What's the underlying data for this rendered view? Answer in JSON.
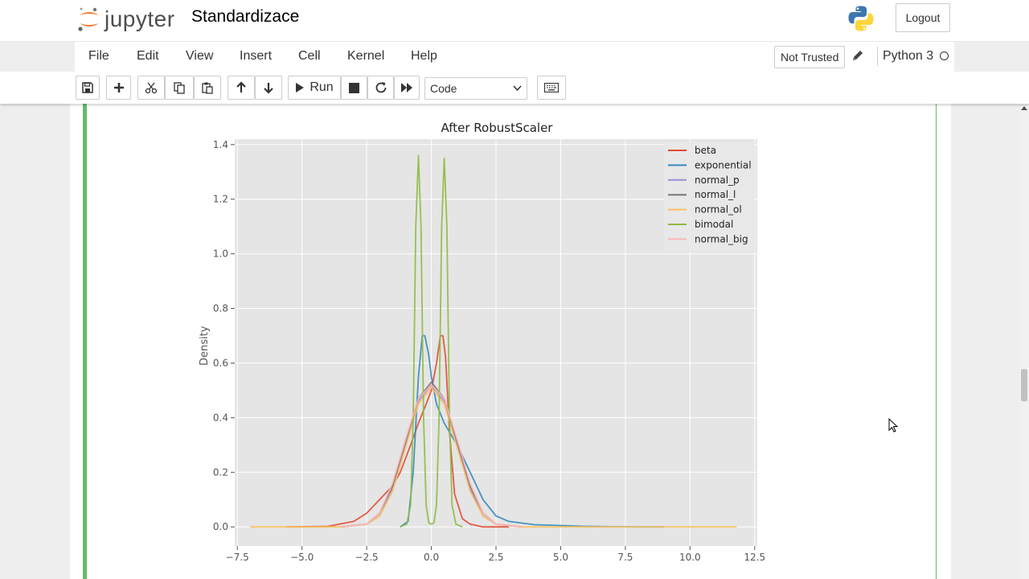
{
  "header": {
    "logo_text": "jupyter",
    "notebook_title": "Standardizace",
    "logout_label": "Logout"
  },
  "menubar": {
    "items": [
      "File",
      "Edit",
      "View",
      "Insert",
      "Cell",
      "Kernel",
      "Help"
    ],
    "trust_label": "Not Trusted",
    "kernel_name": "Python 3"
  },
  "toolbar": {
    "run_label": "Run",
    "cell_type": "Code",
    "icons": [
      "save-icon",
      "plus-icon",
      "scissors-icon",
      "copy-icon",
      "paste-icon",
      "arrow-up-icon",
      "arrow-down-icon",
      "play-icon",
      "stop-icon",
      "restart-icon",
      "fast-forward-icon",
      "keyboard-icon"
    ]
  },
  "colors": {
    "cell_selected": "#66bb6a",
    "plot_bg": "#e5e5e5"
  },
  "chart_data": {
    "type": "line",
    "title": "After RobustScaler",
    "xlabel": "",
    "ylabel": "Density",
    "xlim": [
      -7.6,
      12.6
    ],
    "ylim": [
      -0.07,
      1.42
    ],
    "xticks": [
      -7.5,
      -5.0,
      -2.5,
      0.0,
      2.5,
      5.0,
      7.5,
      10.0,
      12.5
    ],
    "xtick_labels": [
      "−7.5",
      "−5.0",
      "−2.5",
      "0.0",
      "2.5",
      "5.0",
      "7.5",
      "10.0",
      "12.5"
    ],
    "yticks": [
      0.0,
      0.2,
      0.4,
      0.6,
      0.8,
      1.0,
      1.2,
      1.4
    ],
    "ytick_labels": [
      "0.0",
      "0.2",
      "0.4",
      "0.6",
      "0.8",
      "1.0",
      "1.2",
      "1.4"
    ],
    "grid": true,
    "legend_position": "top-right",
    "series": [
      {
        "name": "beta",
        "color": "#e24a33",
        "x": [
          -5.6,
          -4.0,
          -3.0,
          -2.5,
          -2.0,
          -1.5,
          -1.2,
          -1.0,
          -0.8,
          -0.5,
          -0.2,
          0.0,
          0.2,
          0.35,
          0.45,
          0.55,
          0.7,
          0.9,
          1.2,
          1.5,
          2.0,
          3.0
        ],
        "y": [
          0.0,
          0.002,
          0.02,
          0.05,
          0.1,
          0.15,
          0.2,
          0.25,
          0.3,
          0.38,
          0.45,
          0.5,
          0.6,
          0.7,
          0.7,
          0.62,
          0.35,
          0.12,
          0.03,
          0.01,
          0.0,
          0.0
        ]
      },
      {
        "name": "exponential",
        "color": "#348abd",
        "x": [
          -1.2,
          -0.9,
          -0.7,
          -0.5,
          -0.35,
          -0.25,
          -0.1,
          0.0,
          0.2,
          0.5,
          1.0,
          1.5,
          2.0,
          2.5,
          3.0,
          4.0,
          5.0,
          6.0,
          8.0,
          9.0
        ],
        "y": [
          0.0,
          0.02,
          0.2,
          0.55,
          0.7,
          0.7,
          0.63,
          0.55,
          0.45,
          0.38,
          0.3,
          0.2,
          0.1,
          0.04,
          0.02,
          0.008,
          0.005,
          0.002,
          0.0,
          0.0
        ]
      },
      {
        "name": "normal_p",
        "color": "#988ed5",
        "x": [
          -3.5,
          -2.5,
          -2.0,
          -1.5,
          -1.0,
          -0.5,
          0.0,
          0.5,
          1.0,
          1.5,
          2.0,
          2.5,
          3.5
        ],
        "y": [
          0.0,
          0.01,
          0.04,
          0.14,
          0.3,
          0.46,
          0.52,
          0.46,
          0.3,
          0.14,
          0.04,
          0.01,
          0.0
        ]
      },
      {
        "name": "normal_l",
        "color": "#777777",
        "x": [
          -3.5,
          -2.5,
          -2.0,
          -1.5,
          -1.0,
          -0.5,
          0.0,
          0.5,
          1.0,
          1.5,
          2.0,
          2.5,
          3.5
        ],
        "y": [
          0.0,
          0.01,
          0.05,
          0.15,
          0.31,
          0.47,
          0.53,
          0.47,
          0.31,
          0.15,
          0.05,
          0.01,
          0.0
        ]
      },
      {
        "name": "normal_ol",
        "color": "#fbc15e",
        "x": [
          -7.0,
          -3.5,
          -2.5,
          -2.0,
          -1.5,
          -1.0,
          -0.5,
          0.0,
          0.5,
          1.0,
          1.5,
          2.0,
          2.5,
          3.5,
          11.8
        ],
        "y": [
          0.0,
          0.0,
          0.01,
          0.04,
          0.13,
          0.29,
          0.45,
          0.51,
          0.45,
          0.29,
          0.13,
          0.04,
          0.01,
          0.0,
          0.0
        ]
      },
      {
        "name": "bimodal",
        "color": "#8eba42",
        "x": [
          -1.2,
          -0.95,
          -0.8,
          -0.7,
          -0.6,
          -0.5,
          -0.4,
          -0.3,
          -0.2,
          -0.1,
          0.0,
          0.1,
          0.2,
          0.3,
          0.4,
          0.5,
          0.6,
          0.7,
          0.8,
          0.95,
          1.2
        ],
        "y": [
          0.0,
          0.01,
          0.08,
          0.4,
          1.1,
          1.36,
          1.1,
          0.4,
          0.08,
          0.015,
          0.01,
          0.015,
          0.08,
          0.4,
          1.1,
          1.35,
          1.1,
          0.4,
          0.08,
          0.01,
          0.0
        ]
      },
      {
        "name": "normal_big",
        "color": "#ffb5b8",
        "x": [
          -3.5,
          -2.5,
          -2.0,
          -1.5,
          -1.0,
          -0.5,
          0.0,
          0.5,
          1.0,
          1.5,
          2.0,
          2.5,
          3.5
        ],
        "y": [
          0.0,
          0.01,
          0.05,
          0.16,
          0.32,
          0.47,
          0.52,
          0.47,
          0.32,
          0.16,
          0.05,
          0.01,
          0.0
        ]
      }
    ]
  }
}
